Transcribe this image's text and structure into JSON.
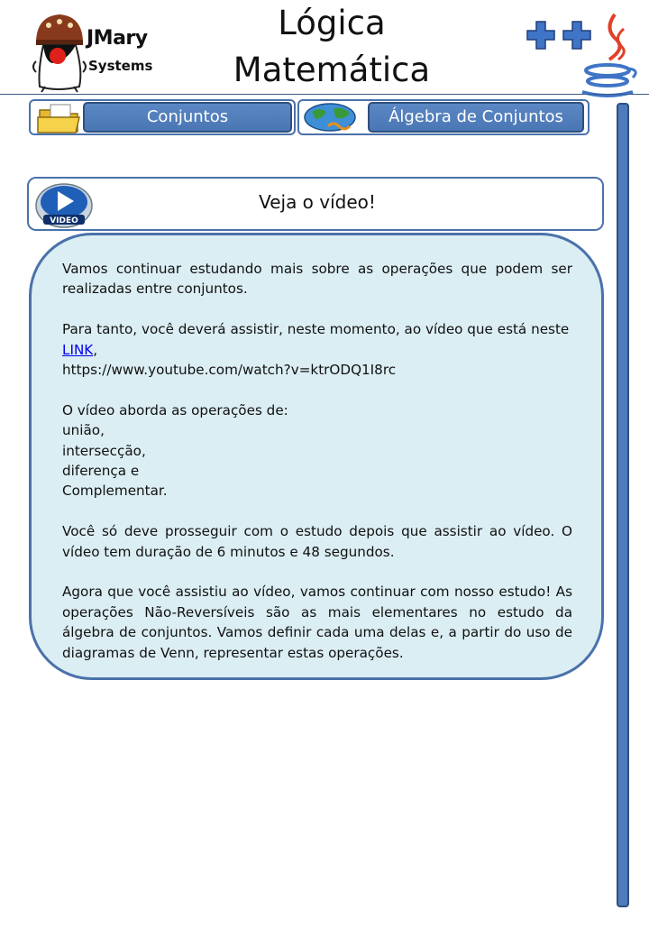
{
  "header": {
    "logo_name": "JMary",
    "logo_sub": "Systems",
    "title_line1": "Lógica",
    "title_line2": "Matemática"
  },
  "nav": {
    "prev_label": "Conjuntos",
    "next_label": "Álgebra de Conjuntos"
  },
  "video": {
    "title": "Veja o vídeo!",
    "icon_label": "VIDEO"
  },
  "content": {
    "p1": "Vamos continuar estudando mais sobre as operações que podem ser realizadas entre conjuntos.",
    "p2": "Para tanto, você deverá assistir, neste momento, ao vídeo que está neste",
    "link_text": "LINK",
    "link_after": ",",
    "url": "https://www.youtube.com/watch?v=ktrODQ1I8rc",
    "p3_intro": "O vídeo aborda as operações de:",
    "ops": [
      "união,",
      "intersecção,",
      "diferença e",
      "Complementar."
    ],
    "p4": "Você só deve prosseguir com o estudo depois que assistir ao vídeo. O vídeo tem duração de 6 minutos e 48 segundos.",
    "p5": "Agora que você assistiu ao vídeo, vamos continuar com nosso estudo! As operações Não-Reversíveis são as mais elementares no estudo da álgebra de conjuntos. Vamos definir cada uma delas e, a partir do uso de diagramas de Venn, representar estas operações."
  },
  "colors": {
    "accent": "#4a72aa",
    "button": "#4f7bbd",
    "panel": "#dbeef4"
  }
}
